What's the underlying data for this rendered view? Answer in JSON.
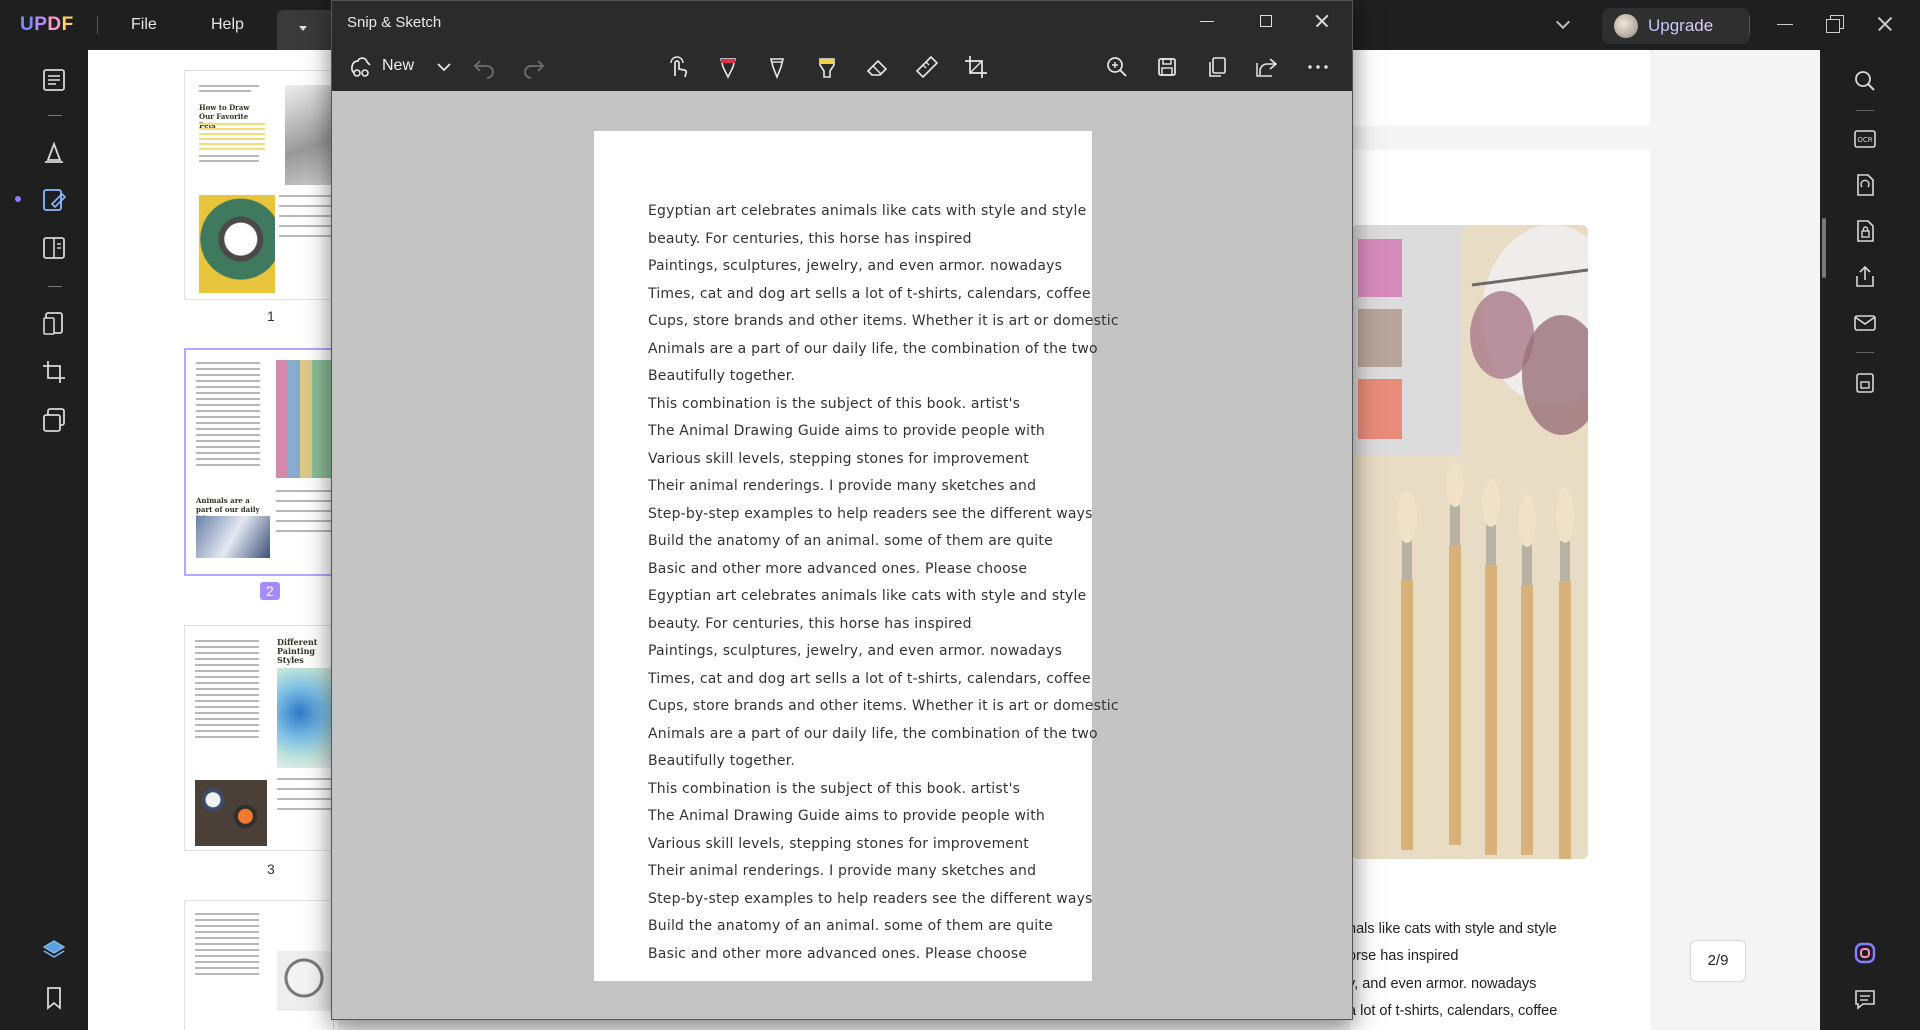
{
  "app": {
    "logo": "UPDF",
    "menu": {
      "file": "File",
      "help": "Help"
    },
    "upgrade_label": "Upgrade"
  },
  "thumbnails": [
    {
      "page_label": "1",
      "heading": "How to Draw Our Favorite Pets",
      "selected": false
    },
    {
      "page_label": "2",
      "heading": "Animals are a part of our daily life",
      "selected": true
    },
    {
      "page_label": "3",
      "heading": "Different Painting Styles",
      "selected": false
    }
  ],
  "document": {
    "visible_lines": [
      "nals like cats with style and style",
      "orse has inspired",
      "y, and even armor. nowadays",
      "a lot of t-shirts, calendars, coffee"
    ],
    "page_indicator": "2/9"
  },
  "snip": {
    "title": "Snip & Sketch",
    "new_label": "New",
    "toolbar_icons": [
      "touch-writing-icon",
      "ballpoint-pen-icon",
      "pencil-icon",
      "highlighter-icon",
      "eraser-icon",
      "ruler-icon",
      "crop-icon",
      "zoom-in-icon",
      "save-icon",
      "copy-icon",
      "share-icon",
      "more-icon"
    ],
    "page_lines": [
      "Egyptian art celebrates animals like cats with style and style",
      "beauty. For centuries, this horse has inspired",
      "Paintings, sculptures, jewelry, and even armor. nowadays",
      "Times, cat and dog art sells a lot of t-shirts, calendars, coffee",
      "Cups, store brands and other items. Whether it is art or domestic",
      "Animals are a part of our daily life, the combination of the two",
      "Beautifully together.",
      "This combination is the subject of this book. artist's",
      "The Animal Drawing Guide aims to provide people with",
      "Various skill levels, stepping stones for improvement",
      "Their animal renderings. I provide many sketches and",
      "Step-by-step examples to help readers see the different ways",
      "Build the anatomy of an animal. some of them are quite",
      "Basic and other more advanced ones. Please choose",
      "Egyptian art celebrates animals like cats with style and style",
      "beauty. For centuries, this horse has inspired",
      "Paintings, sculptures, jewelry, and even armor. nowadays",
      "Times, cat and dog art sells a lot of t-shirts, calendars, coffee",
      "Cups, store brands and other items. Whether it is art or domestic",
      "Animals are a part of our daily life, the combination of the two",
      "Beautifully together.",
      "This combination is the subject of this book. artist's",
      "The Animal Drawing Guide aims to provide people with",
      "Various skill levels, stepping stones for improvement",
      "Their animal renderings. I provide many sketches and",
      "Step-by-step examples to help readers see the different ways",
      "Build the anatomy of an animal. some of them are quite",
      "Basic and other more advanced ones. Please choose"
    ]
  },
  "colors": {
    "accent": "#a58bff",
    "chrome": "#1f1f1f",
    "snip_chrome": "#2b2b2b",
    "snip_canvas": "#c4c4c4",
    "highlighter": "#f2d33d",
    "pen": "#e0334a"
  }
}
